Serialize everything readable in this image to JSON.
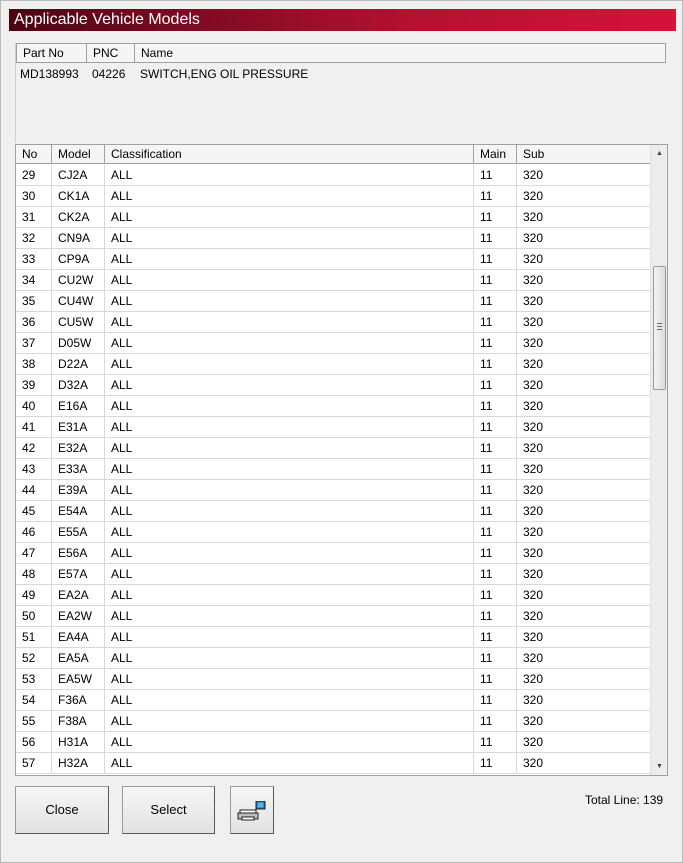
{
  "window": {
    "title": "Applicable Vehicle Models"
  },
  "part_table": {
    "headers": [
      "Part No",
      "PNC",
      "Name"
    ],
    "row": {
      "part_no": "MD138993",
      "pnc": "04226",
      "name": "SWITCH,ENG OIL PRESSURE"
    }
  },
  "models_table": {
    "headers": [
      "No",
      "Model",
      "Classification",
      "Main",
      "Sub"
    ],
    "rows": [
      {
        "no": "29",
        "model": "CJ2A",
        "classification": "ALL",
        "main": "11",
        "sub": "320"
      },
      {
        "no": "30",
        "model": "CK1A",
        "classification": "ALL",
        "main": "11",
        "sub": "320"
      },
      {
        "no": "31",
        "model": "CK2A",
        "classification": "ALL",
        "main": "11",
        "sub": "320"
      },
      {
        "no": "32",
        "model": "CN9A",
        "classification": "ALL",
        "main": "11",
        "sub": "320"
      },
      {
        "no": "33",
        "model": "CP9A",
        "classification": "ALL",
        "main": "11",
        "sub": "320"
      },
      {
        "no": "34",
        "model": "CU2W",
        "classification": "ALL",
        "main": "11",
        "sub": "320"
      },
      {
        "no": "35",
        "model": "CU4W",
        "classification": "ALL",
        "main": "11",
        "sub": "320"
      },
      {
        "no": "36",
        "model": "CU5W",
        "classification": "ALL",
        "main": "11",
        "sub": "320"
      },
      {
        "no": "37",
        "model": "D05W",
        "classification": "ALL",
        "main": "11",
        "sub": "320"
      },
      {
        "no": "38",
        "model": "D22A",
        "classification": "ALL",
        "main": "11",
        "sub": "320"
      },
      {
        "no": "39",
        "model": "D32A",
        "classification": "ALL",
        "main": "11",
        "sub": "320"
      },
      {
        "no": "40",
        "model": "E16A",
        "classification": "ALL",
        "main": "11",
        "sub": "320"
      },
      {
        "no": "41",
        "model": "E31A",
        "classification": "ALL",
        "main": "11",
        "sub": "320"
      },
      {
        "no": "42",
        "model": "E32A",
        "classification": "ALL",
        "main": "11",
        "sub": "320"
      },
      {
        "no": "43",
        "model": "E33A",
        "classification": "ALL",
        "main": "11",
        "sub": "320"
      },
      {
        "no": "44",
        "model": "E39A",
        "classification": "ALL",
        "main": "11",
        "sub": "320"
      },
      {
        "no": "45",
        "model": "E54A",
        "classification": "ALL",
        "main": "11",
        "sub": "320"
      },
      {
        "no": "46",
        "model": "E55A",
        "classification": "ALL",
        "main": "11",
        "sub": "320"
      },
      {
        "no": "47",
        "model": "E56A",
        "classification": "ALL",
        "main": "11",
        "sub": "320"
      },
      {
        "no": "48",
        "model": "E57A",
        "classification": "ALL",
        "main": "11",
        "sub": "320"
      },
      {
        "no": "49",
        "model": "EA2A",
        "classification": "ALL",
        "main": "11",
        "sub": "320"
      },
      {
        "no": "50",
        "model": "EA2W",
        "classification": "ALL",
        "main": "11",
        "sub": "320"
      },
      {
        "no": "51",
        "model": "EA4A",
        "classification": "ALL",
        "main": "11",
        "sub": "320"
      },
      {
        "no": "52",
        "model": "EA5A",
        "classification": "ALL",
        "main": "11",
        "sub": "320"
      },
      {
        "no": "53",
        "model": "EA5W",
        "classification": "ALL",
        "main": "11",
        "sub": "320"
      },
      {
        "no": "54",
        "model": "F36A",
        "classification": "ALL",
        "main": "11",
        "sub": "320"
      },
      {
        "no": "55",
        "model": "F38A",
        "classification": "ALL",
        "main": "11",
        "sub": "320"
      },
      {
        "no": "56",
        "model": "H31A",
        "classification": "ALL",
        "main": "11",
        "sub": "320"
      },
      {
        "no": "57",
        "model": "H32A",
        "classification": "ALL",
        "main": "11",
        "sub": "320"
      }
    ]
  },
  "buttons": {
    "close": "Close",
    "select": "Select",
    "print_icon": "printer-icon"
  },
  "footer": {
    "total_line": "Total Line: 139"
  },
  "scroll_position": 0.22,
  "colors": {
    "title_start": "#4a0510",
    "title_end": "#d4123a"
  }
}
